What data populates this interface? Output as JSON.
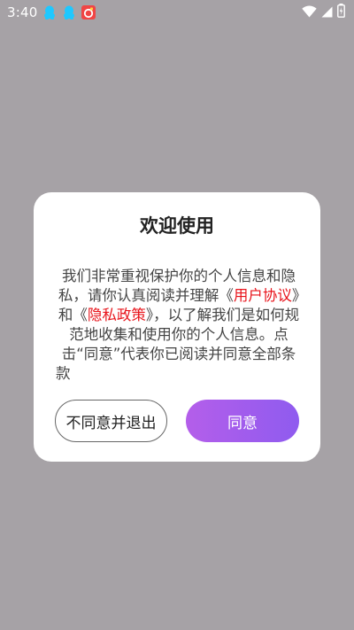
{
  "status_bar": {
    "time": "3:40",
    "notification_icons": [
      "qq-icon",
      "qq-icon",
      "camera-app-icon"
    ],
    "system_icons": [
      "wifi-icon",
      "cell-signal-icon",
      "battery-icon"
    ]
  },
  "dialog": {
    "title": "欢迎使用",
    "body": {
      "text_1": "我们非常重视保护你的个人信息和隐私，请你认真阅读并理解《",
      "link_user_agreement": "用户协议",
      "text_2": "》和《",
      "link_privacy_policy": "隐私政策",
      "text_3": "》，以了解我们是如何规范地收集和使用你的个人信息。点击“同意”代表你已阅读并同意全部条款"
    },
    "decline_label": "不同意并退出",
    "agree_label": "同意"
  },
  "colors": {
    "overlay": "#a6a2a6",
    "link": "#e8131a",
    "agree_gradient_start": "#b45eea",
    "agree_gradient_end": "#8f5bef"
  }
}
